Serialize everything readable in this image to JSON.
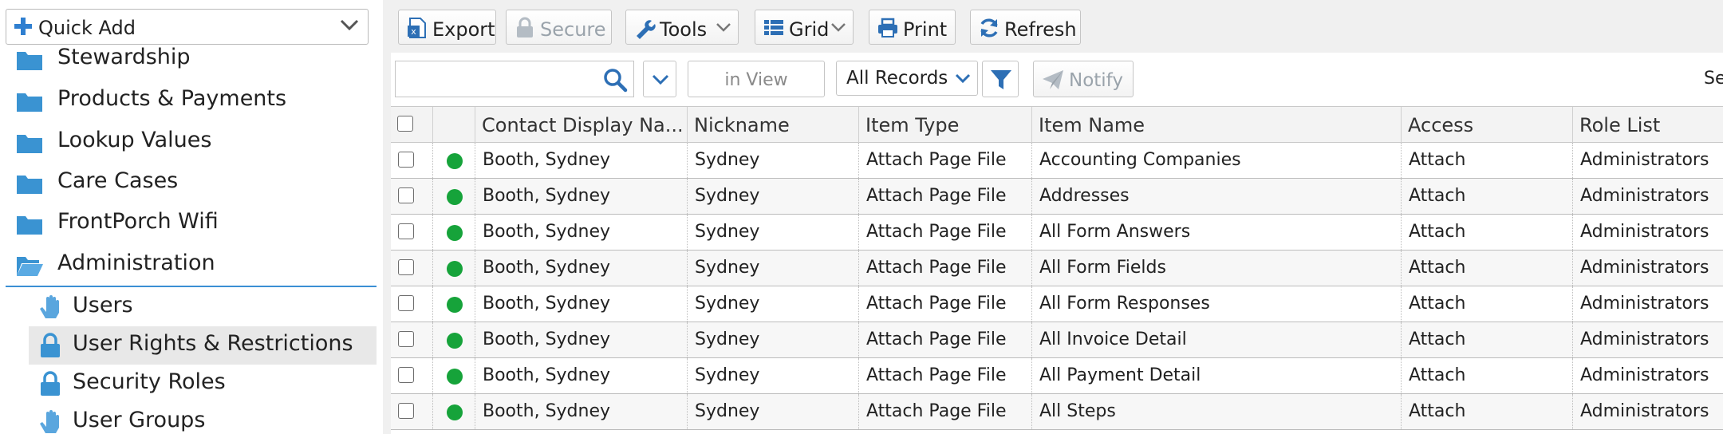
{
  "sidebar": {
    "quick_add_label": "Quick Add",
    "items": [
      {
        "label": "Stewardship",
        "icon": "folder-icon"
      },
      {
        "label": "Products & Payments",
        "icon": "folder-icon"
      },
      {
        "label": "Lookup Values",
        "icon": "folder-icon"
      },
      {
        "label": "Care Cases",
        "icon": "folder-icon"
      },
      {
        "label": "FrontPorch Wifi",
        "icon": "folder-icon"
      },
      {
        "label": "Administration",
        "icon": "folder-open-icon",
        "expanded": true
      }
    ],
    "sub_items": [
      {
        "label": "Users",
        "icon": "hand-icon",
        "active": false
      },
      {
        "label": "User Rights & Restrictions",
        "icon": "lock-icon",
        "active": true
      },
      {
        "label": "Security Roles",
        "icon": "lock-icon",
        "active": false
      },
      {
        "label": "User Groups",
        "icon": "hand-icon",
        "active": false
      }
    ]
  },
  "toolbar": {
    "export_label": "Export",
    "secure_label": "Secure",
    "tools_label": "Tools",
    "grid_label": "Grid",
    "print_label": "Print",
    "refresh_label": "Refresh"
  },
  "filterbar": {
    "search_value": "",
    "in_view_label": "in View",
    "records_filter": "All Records",
    "notify_label": "Notify",
    "truncated_right_text": "Se"
  },
  "grid": {
    "columns": [
      "Contact Display Na...",
      "Nickname",
      "Item Type",
      "Item Name",
      "Access",
      "Role List"
    ],
    "rows": [
      {
        "contact": "Booth, Sydney",
        "nickname": "Sydney",
        "item_type": "Attach Page File",
        "item_name": "Accounting Companies",
        "access": "Attach",
        "role_list": "Administrators"
      },
      {
        "contact": "Booth, Sydney",
        "nickname": "Sydney",
        "item_type": "Attach Page File",
        "item_name": "Addresses",
        "access": "Attach",
        "role_list": "Administrators"
      },
      {
        "contact": "Booth, Sydney",
        "nickname": "Sydney",
        "item_type": "Attach Page File",
        "item_name": "All Form Answers",
        "access": "Attach",
        "role_list": "Administrators"
      },
      {
        "contact": "Booth, Sydney",
        "nickname": "Sydney",
        "item_type": "Attach Page File",
        "item_name": "All Form Fields",
        "access": "Attach",
        "role_list": "Administrators"
      },
      {
        "contact": "Booth, Sydney",
        "nickname": "Sydney",
        "item_type": "Attach Page File",
        "item_name": "All Form Responses",
        "access": "Attach",
        "role_list": "Administrators"
      },
      {
        "contact": "Booth, Sydney",
        "nickname": "Sydney",
        "item_type": "Attach Page File",
        "item_name": "All Invoice Detail",
        "access": "Attach",
        "role_list": "Administrators"
      },
      {
        "contact": "Booth, Sydney",
        "nickname": "Sydney",
        "item_type": "Attach Page File",
        "item_name": "All Payment Detail",
        "access": "Attach",
        "role_list": "Administrators"
      },
      {
        "contact": "Booth, Sydney",
        "nickname": "Sydney",
        "item_type": "Attach Page File",
        "item_name": "All Steps",
        "access": "Attach",
        "role_list": "Administrators"
      }
    ]
  },
  "colors": {
    "accent_blue": "#3b8fd4",
    "status_active": "#16a33a",
    "disabled_text": "#9aa3ab"
  }
}
